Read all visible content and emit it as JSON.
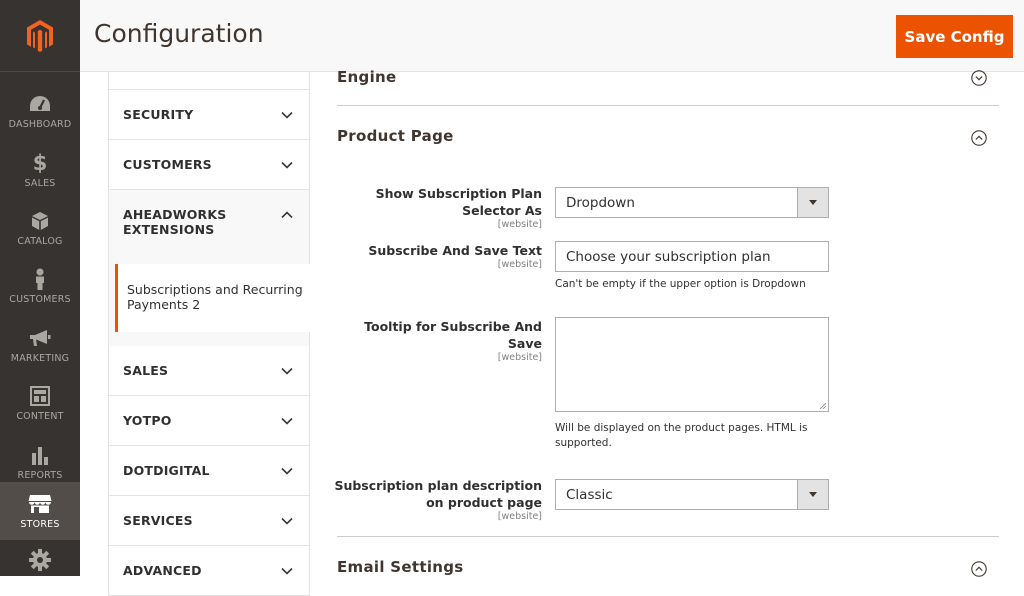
{
  "header": {
    "title": "Configuration",
    "save_label": "Save Config"
  },
  "admin_nav": [
    {
      "label": "DASHBOARD",
      "icon": "dashboard-icon"
    },
    {
      "label": "SALES",
      "icon": "dollar-icon"
    },
    {
      "label": "CATALOG",
      "icon": "cube-icon"
    },
    {
      "label": "CUSTOMERS",
      "icon": "person-icon"
    },
    {
      "label": "MARKETING",
      "icon": "megaphone-icon"
    },
    {
      "label": "CONTENT",
      "icon": "content-icon"
    },
    {
      "label": "REPORTS",
      "icon": "bar-chart-icon"
    },
    {
      "label": "STORES",
      "icon": "store-icon",
      "active": true
    },
    {
      "label": "",
      "icon": "gear-icon"
    }
  ],
  "tabs": {
    "security": "SECURITY",
    "customers": "CUSTOMERS",
    "aheadworks": "AHEADWORKS EXTENSIONS",
    "sub": "Subscriptions and Recurring Payments 2",
    "sales": "SALES",
    "yotpo": "YOTPO",
    "dotdigital": "DOTDIGITAL",
    "services": "SERVICES",
    "advanced": "ADVANCED"
  },
  "sections": {
    "engine": "Engine",
    "product_page": "Product Page",
    "email": "Email Settings"
  },
  "fields": {
    "selector": {
      "label": "Show Subscription Plan Selector As",
      "scope": "[website]",
      "value": "Dropdown"
    },
    "subscribe": {
      "label": "Subscribe And Save Text",
      "scope": "[website]",
      "value": "Choose your subscription plan",
      "note": "Can't be empty if the upper option is Dropdown"
    },
    "tooltip": {
      "label": "Tooltip for Subscribe And Save",
      "scope": "[website]",
      "value": "",
      "note": "Will be displayed on the product pages. HTML is supported."
    },
    "description": {
      "label": "Subscription plan description on product page",
      "scope": "[website]",
      "value": "Classic"
    }
  },
  "colors": {
    "accent": "#eb5202",
    "nav_bg": "#373330",
    "nav_active": "#524d49"
  }
}
